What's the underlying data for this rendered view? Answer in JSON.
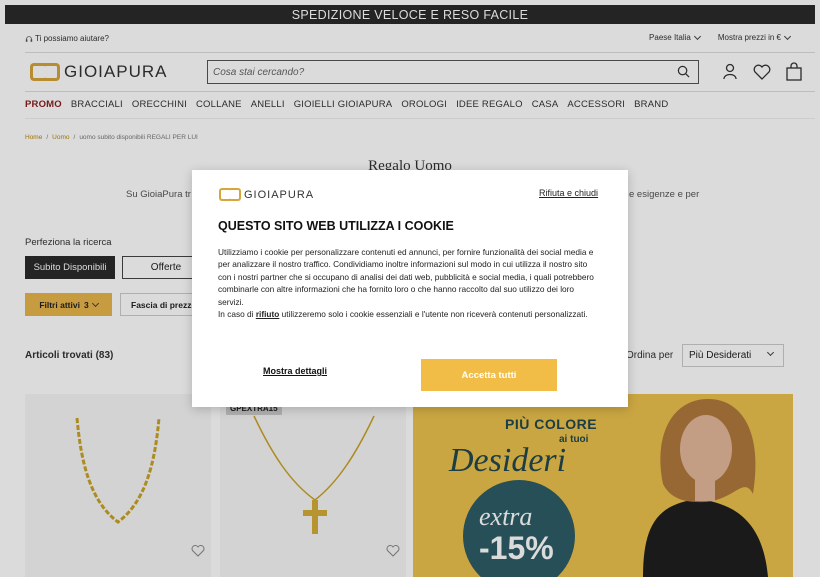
{
  "topbar": {
    "text": "SPEDIZIONE VELOCE E RESO FACILE"
  },
  "utility": {
    "help": "Ti possiamo aiutare?",
    "country": "Paese Italia",
    "currency": "Mostra prezzi in €"
  },
  "header": {
    "logo": "GIOIAPURA",
    "search_placeholder": "Cosa stai cercando?"
  },
  "nav": [
    "PROMO",
    "BRACCIALI",
    "ORECCHINI",
    "COLLANE",
    "ANELLI",
    "GIOIELLI GIOIAPURA",
    "OROLOGI",
    "IDEE REGALO",
    "CASA",
    "ACCESSORI",
    "BRAND"
  ],
  "breadcrumb": {
    "home": "Home",
    "uomo": "Uomo",
    "current": "uomo subito disponibili REGALI PER LUI"
  },
  "page": {
    "title": "Regalo Uomo",
    "intro_left": "Su GioiaPura tr",
    "intro_right": "e esigenze e per"
  },
  "filters": {
    "refine_label": "Perfeziona la ricerca",
    "available": "Subito Disponibili",
    "offers": "Offerte",
    "active": "Filtri attivi",
    "active_count": "3",
    "price": "Fascia di prezzo"
  },
  "results": {
    "found": "Articoli trovati (83)",
    "sort_label": "Ordina per",
    "sort_value": "Più Desiderati"
  },
  "products": [
    {
      "badge": ""
    },
    {
      "badge": "GPEXTRA15"
    }
  ],
  "banner": {
    "line1": "PIÙ COLORE",
    "line2": "ai tuoi",
    "line3": "Desideri",
    "line4": "extra",
    "line5": "-15%"
  },
  "cookie": {
    "logo": "GIOIAPURA",
    "reject": "Rifiuta e chiudi",
    "title": "QUESTO SITO WEB UTILIZZA I COOKIE",
    "body1": "Utilizziamo i cookie per personalizzare contenuti ed annunci, per fornire funzionalità dei social media e per analizzare il nostro traffico. Condividiamo inoltre informazioni sul modo in cui utilizza il nostro sito con i nostri partner che si occupano di analisi dei dati web, pubblicità e social media, i quali potrebbero combinarle con altre informazioni che ha fornito loro o che hanno raccolto dal suo utilizzo dei loro servizi.",
    "body2_pre": "In caso di ",
    "body2_link": "rifiuto",
    "body2_post": " utilizzeremo solo i cookie essenziali e l'utente non riceverà contenuti personalizzati.",
    "details": "Mostra dettagli",
    "accept": "Accetta tutti"
  },
  "colors": {
    "gold": "#e8b54a",
    "dark": "#2b2b2b",
    "promo_red": "#8b1e1e",
    "accept": "#f1bd46",
    "banner_teal": "#2e5d66"
  }
}
